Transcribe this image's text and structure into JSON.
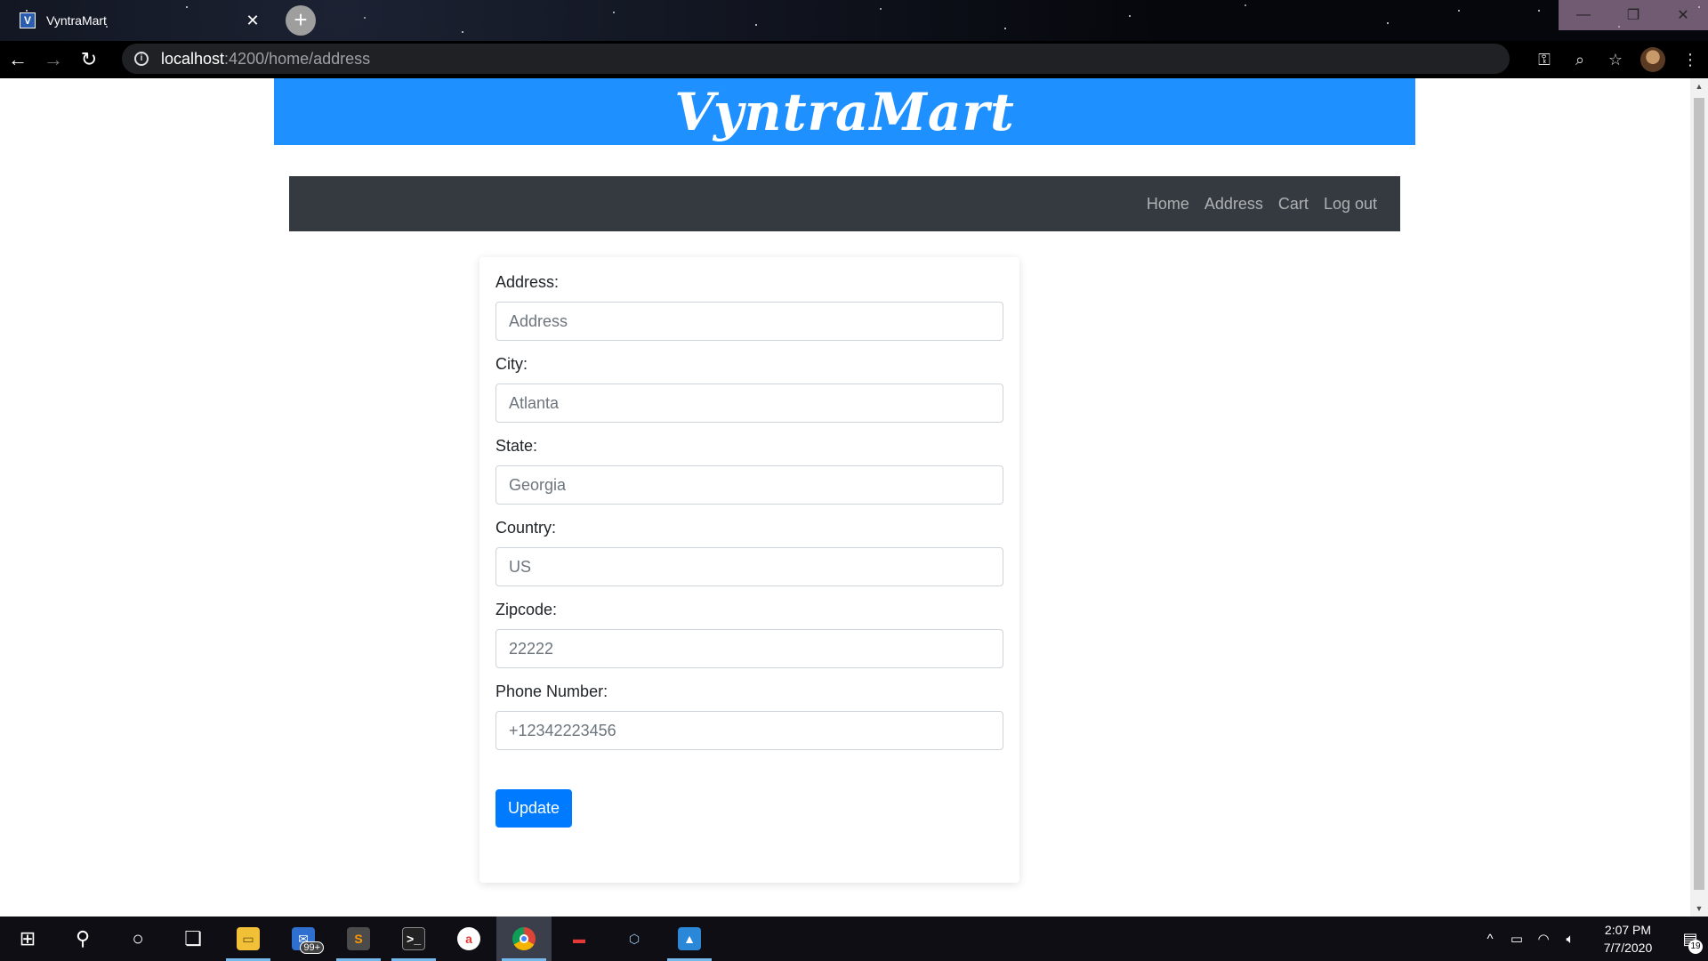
{
  "browser": {
    "tab_title": "VyntraMart",
    "tab_favicon": "V",
    "url_host": "localhost",
    "url_path": ":4200/home/address"
  },
  "header": {
    "brand": "VyntraMart",
    "brand_color": "#1e90ff"
  },
  "nav": {
    "items": [
      "Home",
      "Address",
      "Cart",
      "Log out"
    ],
    "background": "#343a40"
  },
  "form": {
    "fields": [
      {
        "label": "Address:",
        "placeholder": "Address",
        "value": ""
      },
      {
        "label": "City:",
        "placeholder": "Atlanta",
        "value": ""
      },
      {
        "label": "State:",
        "placeholder": "Georgia",
        "value": ""
      },
      {
        "label": "Country:",
        "placeholder": "US",
        "value": ""
      },
      {
        "label": "Zipcode:",
        "placeholder": "22222",
        "value": ""
      },
      {
        "label": "Phone Number:",
        "placeholder": "+12342223456",
        "value": ""
      }
    ],
    "submit_label": "Update",
    "submit_color": "#007bff"
  },
  "taskbar": {
    "mail_badge": "99+",
    "time": "2:07 PM",
    "date": "7/7/2020",
    "notifications": "19"
  }
}
